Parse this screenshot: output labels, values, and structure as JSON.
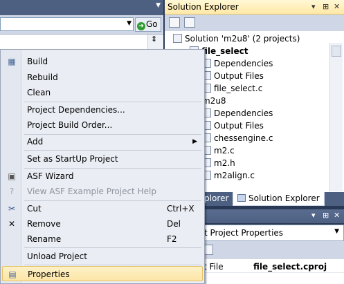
{
  "toolbar": {
    "go_label": "Go"
  },
  "solution_explorer": {
    "title": "Solution Explorer",
    "controls": [
      "▾",
      "⊞",
      "✕"
    ],
    "tree": [
      {
        "label": "Solution 'm2u8' (2 projects)",
        "bold": false
      },
      {
        "label": "file_select",
        "bold": true
      },
      {
        "label": "Dependencies",
        "bold": false
      },
      {
        "label": "Output Files",
        "bold": false
      },
      {
        "label": "file_select.c",
        "bold": false
      },
      {
        "label": "m2u8",
        "bold": false
      },
      {
        "label": "Dependencies",
        "bold": false
      },
      {
        "label": "Output Files",
        "bold": false
      },
      {
        "label": "chessengine.c",
        "bold": false
      },
      {
        "label": "m2.c",
        "bold": false
      },
      {
        "label": "m2.h",
        "bold": false
      },
      {
        "label": "m2align.c",
        "bold": false
      }
    ]
  },
  "tabs": [
    {
      "label": "xplorer",
      "active": false
    },
    {
      "label": "Solution Explorer",
      "active": true
    }
  ],
  "properties": {
    "controls": [
      "▾",
      "⊞",
      "✕"
    ],
    "object_combo": "t Project Properties",
    "rows": [
      {
        "name": "t File",
        "value": "file_select.cproj"
      }
    ]
  },
  "context_menu": {
    "items": [
      {
        "label": "Build",
        "icon": "build-icon",
        "shortcut": "",
        "submenu": false,
        "disabled": false
      },
      {
        "label": "Rebuild",
        "icon": "",
        "shortcut": "",
        "submenu": false,
        "disabled": false
      },
      {
        "label": "Clean",
        "icon": "",
        "shortcut": "",
        "submenu": false,
        "disabled": false
      },
      {
        "label": "Project Dependencies...",
        "icon": "",
        "shortcut": "",
        "submenu": false,
        "disabled": false
      },
      {
        "label": "Project Build Order...",
        "icon": "",
        "shortcut": "",
        "submenu": false,
        "disabled": false
      },
      {
        "label": "Add",
        "icon": "",
        "shortcut": "",
        "submenu": true,
        "disabled": false
      },
      {
        "label": "Set as StartUp Project",
        "icon": "",
        "shortcut": "",
        "submenu": false,
        "disabled": false
      },
      {
        "label": "ASF Wizard",
        "icon": "asf-wizard-icon",
        "shortcut": "",
        "submenu": false,
        "disabled": false
      },
      {
        "label": "View ASF Example Project Help",
        "icon": "help-icon",
        "shortcut": "",
        "submenu": false,
        "disabled": true
      },
      {
        "label": "Cut",
        "icon": "scissors-icon",
        "shortcut": "Ctrl+X",
        "submenu": false,
        "disabled": false
      },
      {
        "label": "Remove",
        "icon": "remove-x-icon",
        "shortcut": "Del",
        "submenu": false,
        "disabled": false
      },
      {
        "label": "Rename",
        "icon": "",
        "shortcut": "F2",
        "submenu": false,
        "disabled": false
      },
      {
        "label": "Unload Project",
        "icon": "",
        "shortcut": "",
        "submenu": false,
        "disabled": false
      },
      {
        "label": "Properties",
        "icon": "properties-icon",
        "shortcut": "",
        "submenu": false,
        "disabled": false,
        "highlighted": true
      }
    ]
  }
}
